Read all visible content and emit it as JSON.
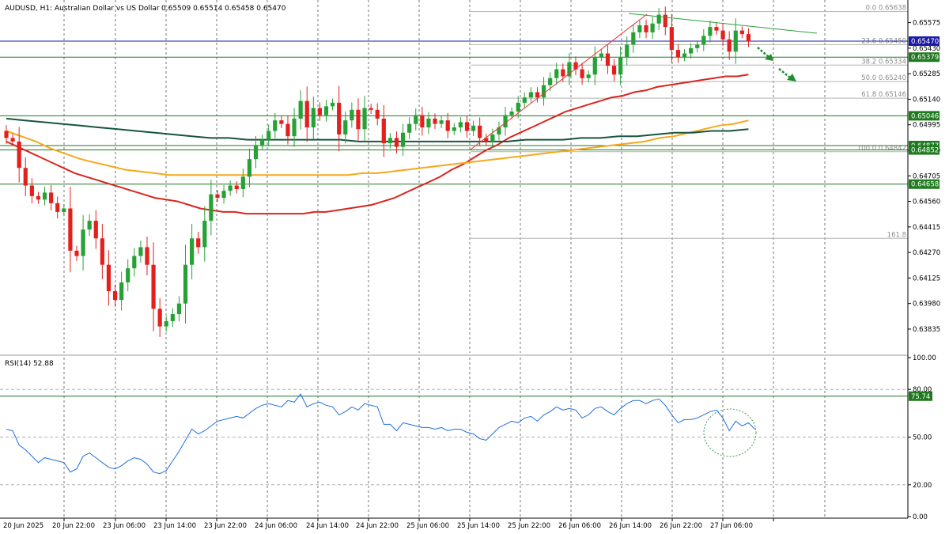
{
  "chart_data": [
    {
      "type": "candlestick",
      "symbol_label": "AUDUSD, H1:  Australian Dollar vs US Dollar",
      "ohlc_label": "0.65509 0.65514 0.65458 0.65470",
      "ylim": [
        0.637,
        0.6569
      ],
      "y_ticks": [
        "0.65575",
        "0.65430",
        "0.65285",
        "0.65140",
        "0.64995",
        "0.64850",
        "0.64705",
        "0.64560",
        "0.64415",
        "0.64270",
        "0.64125",
        "0.63980",
        "0.63835"
      ],
      "x_ticks": [
        "20 Jun 2025",
        "20 Jun 22:00",
        "23 Jun 06:00",
        "23 Jun 14:00",
        "23 Jun 22:00",
        "24 Jun 06:00",
        "24 Jun 14:00",
        "24 Jun 22:00",
        "25 Jun 06:00",
        "25 Jun 14:00",
        "25 Jun 22:00",
        "26 Jun 06:00",
        "26 Jun 14:00",
        "26 Jun 22:00",
        "27 Jun 06:00"
      ],
      "close": [
        0.6492,
        0.649,
        0.6475,
        0.6465,
        0.6459,
        0.6457,
        0.6461,
        0.6455,
        0.645,
        0.6452,
        0.6428,
        0.6425,
        0.644,
        0.6445,
        0.6435,
        0.642,
        0.6405,
        0.64,
        0.641,
        0.6418,
        0.6425,
        0.643,
        0.642,
        0.6395,
        0.6385,
        0.6388,
        0.6392,
        0.6398,
        0.642,
        0.6435,
        0.643,
        0.6445,
        0.646,
        0.6458,
        0.6462,
        0.6465,
        0.6463,
        0.647,
        0.648,
        0.6488,
        0.6491,
        0.6496,
        0.6502,
        0.65,
        0.6493,
        0.6503,
        0.6513,
        0.6498,
        0.6509,
        0.6505,
        0.651,
        0.6512,
        0.6494,
        0.6502,
        0.6508,
        0.6497,
        0.6509,
        0.6508,
        0.6503,
        0.6489,
        0.6492,
        0.6487,
        0.6495,
        0.65,
        0.6505,
        0.6498,
        0.6503,
        0.65,
        0.6502,
        0.6496,
        0.6498,
        0.6501,
        0.6496,
        0.6499,
        0.6492,
        0.649,
        0.6494,
        0.6498,
        0.6505,
        0.6507,
        0.6512,
        0.6515,
        0.6518,
        0.6515,
        0.6522,
        0.6526,
        0.6531,
        0.6527,
        0.6535,
        0.6531,
        0.6526,
        0.6528,
        0.6538,
        0.654,
        0.6533,
        0.6528,
        0.6538,
        0.6545,
        0.6552,
        0.6556,
        0.6552,
        0.6557,
        0.6562,
        0.6555,
        0.6542,
        0.6538,
        0.654,
        0.6543,
        0.6545,
        0.655,
        0.6555,
        0.6553,
        0.6548,
        0.6541,
        0.6553,
        0.6551,
        0.6547
      ],
      "series": [
        {
          "color": "#d8261f",
          "values": [
            0.649,
            0.6487,
            0.6484,
            0.6481,
            0.6478,
            0.6475,
            0.6472,
            0.647,
            0.6468,
            0.6466,
            0.6464,
            0.6462,
            0.646,
            0.6458,
            0.6457,
            0.6456,
            0.6454,
            0.6452,
            0.6451,
            0.645,
            0.645,
            0.6449,
            0.6449,
            0.6449,
            0.6449,
            0.6449,
            0.6449,
            0.645,
            0.645,
            0.6451,
            0.6452,
            0.6453,
            0.6454,
            0.6456,
            0.6458,
            0.6461,
            0.6464,
            0.6467,
            0.647,
            0.6474,
            0.6477,
            0.6481,
            0.6485,
            0.6488,
            0.6492,
            0.6495,
            0.6498,
            0.6501,
            0.6504,
            0.6507,
            0.6509,
            0.6511,
            0.6513,
            0.6515,
            0.6516,
            0.6518,
            0.6519,
            0.6521,
            0.6522,
            0.6523,
            0.6524,
            0.6525,
            0.6526,
            0.6527,
            0.6527,
            0.6528
          ]
        },
        {
          "color": "#f7a81b",
          "values": [
            0.6496,
            0.6493,
            0.649,
            0.6486,
            0.6483,
            0.648,
            0.6478,
            0.6476,
            0.6474,
            0.6473,
            0.6472,
            0.6471,
            0.6471,
            0.6471,
            0.6471,
            0.6471,
            0.6471,
            0.6471,
            0.6471,
            0.6471,
            0.6471,
            0.6471,
            0.6471,
            0.6471,
            0.6472,
            0.6472,
            0.6473,
            0.6474,
            0.6475,
            0.6476,
            0.6477,
            0.6478,
            0.6479,
            0.648,
            0.6481,
            0.6482,
            0.6483,
            0.6484,
            0.6485,
            0.6486,
            0.6487,
            0.6488,
            0.6489,
            0.649,
            0.6492,
            0.6493,
            0.6495,
            0.6497,
            0.6499,
            0.65,
            0.6502
          ]
        },
        {
          "color": "#17553f",
          "values": [
            0.6503,
            0.6502,
            0.6501,
            0.65,
            0.6499,
            0.6498,
            0.6497,
            0.6496,
            0.6495,
            0.6494,
            0.6493,
            0.6492,
            0.6492,
            0.6491,
            0.6491,
            0.6491,
            0.6491,
            0.6491,
            0.6491,
            0.649,
            0.649,
            0.649,
            0.649,
            0.649,
            0.649,
            0.649,
            0.649,
            0.649,
            0.6491,
            0.6491,
            0.6491,
            0.6492,
            0.6492,
            0.6493,
            0.6493,
            0.6494,
            0.6495,
            0.6495,
            0.6496,
            0.6496,
            0.6497
          ]
        }
      ],
      "fibonacci": [
        {
          "label": "0.0 0.65638",
          "value": 0.65638
        },
        {
          "label": "23.6 0.65450",
          "value": 0.6545
        },
        {
          "label": "38.2 0.65334",
          "value": 0.65334
        },
        {
          "label": "50.0 0.65240",
          "value": 0.6524
        },
        {
          "label": "61.8 0.65146",
          "value": 0.65146
        },
        {
          "label": "100.0 0.64842",
          "value": 0.64842
        },
        {
          "label": "161.8",
          "value": 0.6435
        }
      ],
      "price_levels": [
        {
          "label": "0.65470",
          "value": 0.6547,
          "color": "#1a1aa8"
        },
        {
          "label": "0.65379",
          "value": 0.65379,
          "color": "#1f7a1f"
        },
        {
          "label": "0.65046",
          "value": 0.65046,
          "color": "#1f7a1f"
        },
        {
          "label": "0.64877",
          "value": 0.64877,
          "color": "#1f7a1f"
        },
        {
          "label": "0.64852",
          "value": 0.64852,
          "color": "#1f7a1f"
        },
        {
          "label": "0.64658",
          "value": 0.64658,
          "color": "#1f7a1f"
        }
      ],
      "colors": {
        "bull": "#26a136",
        "bear": "#e3201c"
      }
    },
    {
      "type": "line",
      "title": "RSI(14) 52.88",
      "ylim": [
        0,
        100
      ],
      "y_ticks": [
        "100.00",
        "80.00",
        "50.00",
        "20.00",
        "0.00"
      ],
      "level_label": "75.74",
      "level_value": 75.74,
      "series": [
        {
          "color": "#1f6fe0",
          "values": [
            55,
            54,
            45,
            42,
            38,
            34,
            37,
            36,
            35,
            34,
            28,
            30,
            38,
            40,
            37,
            34,
            31,
            30,
            32,
            35,
            37,
            36,
            33,
            28,
            27,
            29,
            35,
            41,
            48,
            55,
            52,
            54,
            57,
            60,
            61,
            62,
            63,
            62,
            65,
            68,
            70,
            71,
            70,
            69,
            73,
            72,
            77,
            69,
            71,
            72,
            70,
            69,
            64,
            66,
            69,
            67,
            71,
            70,
            69,
            58,
            58,
            54,
            59,
            58,
            57,
            56,
            56,
            55,
            56,
            54,
            55,
            55,
            53,
            52,
            49,
            48,
            52,
            56,
            58,
            60,
            59,
            62,
            63,
            60,
            64,
            66,
            69,
            67,
            68,
            67,
            62,
            64,
            68,
            69,
            66,
            64,
            68,
            71,
            73,
            73,
            71,
            73,
            74,
            70,
            64,
            59,
            61,
            61,
            62,
            64,
            66,
            67,
            62,
            54,
            60,
            57,
            59,
            55
          ]
        }
      ]
    }
  ]
}
